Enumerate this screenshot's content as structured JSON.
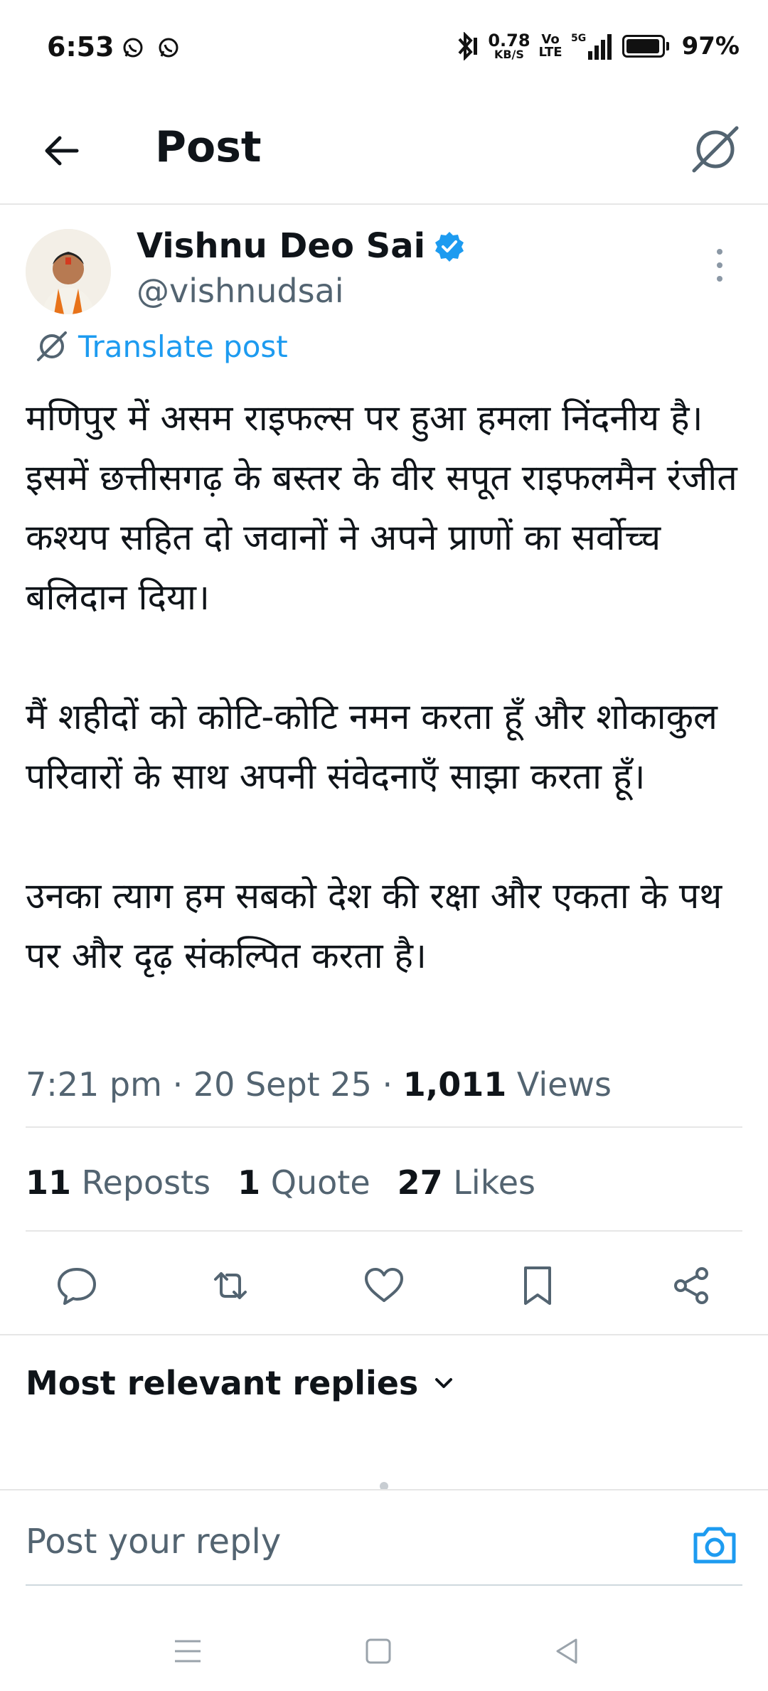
{
  "status_bar": {
    "time": "6:53",
    "speed_value": "0.78",
    "speed_unit": "KB/S",
    "volte_top": "Vo",
    "volte_bottom": "LTE",
    "network": "5G",
    "battery_percent": "97%",
    "battery_level": 0.97
  },
  "header": {
    "title": "Post"
  },
  "author": {
    "name": "Vishnu Deo Sai",
    "handle": "@vishnudsai",
    "verified": true
  },
  "translate": {
    "label": "Translate post"
  },
  "post": {
    "paragraphs": [
      "मणिपुर में असम राइफल्स पर हुआ हमला निंदनीय है। इसमें छत्तीसगढ़ के बस्तर के वीर सपूत राइफलमैन रंजीत कश्यप सहित दो जवानों ने अपने प्राणों का सर्वोच्च बलिदान दिया।",
      "मैं शहीदों को कोटि-कोटि नमन करता हूँ और शोकाकुल परिवारों के साथ अपनी संवेदनाएँ साझा करता हूँ।",
      "उनका त्याग हम सबको देश की रक्षा और एकता के पथ पर और दृढ़ संकल्पित करता है।"
    ],
    "time": "7:21 pm",
    "date": "20 Sept 25",
    "views_count": "1,011",
    "views_label": "Views",
    "separator": "·"
  },
  "stats": {
    "reposts_count": "11",
    "reposts_label": "Reposts",
    "quotes_count": "1",
    "quotes_label": "Quote",
    "likes_count": "27",
    "likes_label": "Likes"
  },
  "actions": [
    "reply-icon",
    "repost-icon",
    "like-icon",
    "bookmark-icon",
    "share-icon"
  ],
  "replies": {
    "sort_label": "Most relevant replies"
  },
  "reply_box": {
    "placeholder": "Post your reply"
  },
  "colors": {
    "accent": "#1d9bf0",
    "text_primary": "#0f1419",
    "text_secondary": "#536471",
    "divider": "#e6e6e6"
  }
}
